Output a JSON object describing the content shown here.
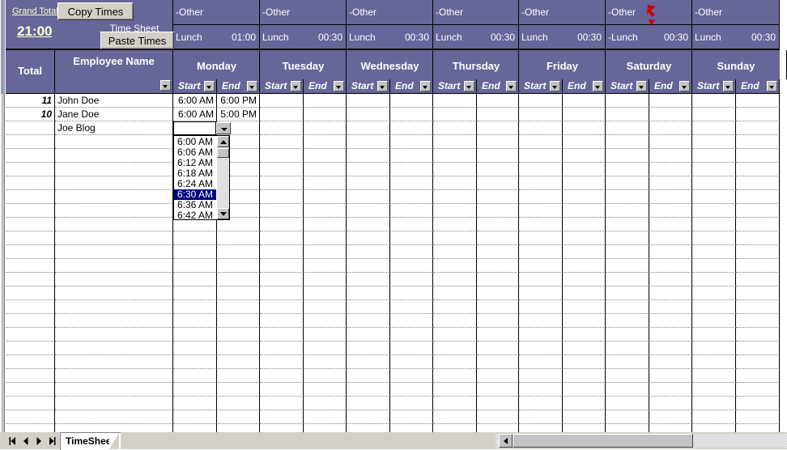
{
  "window": {
    "title": "Time Sheet"
  },
  "summary": {
    "grand_total_label": "Grand Total",
    "grand_total_value": "21:00",
    "sheet_title": "Time Sheet"
  },
  "buttons": {
    "copy_times": "Copy Times",
    "paste_times": "Paste Times"
  },
  "other_label": "-Other",
  "columns": {
    "total": "Total",
    "employee_name": "Employee Name",
    "start": "Start",
    "end": "End"
  },
  "days": [
    {
      "name": "Monday",
      "other": "-Other",
      "lunch_label": "Lunch",
      "lunch_value": "01:00"
    },
    {
      "name": "Tuesday",
      "other": "-Other",
      "lunch_label": "Lunch",
      "lunch_value": "00:30"
    },
    {
      "name": "Wednesday",
      "other": "-Other",
      "lunch_label": "Lunch",
      "lunch_value": "00:30"
    },
    {
      "name": "Thursday",
      "other": "-Other",
      "lunch_label": "Lunch",
      "lunch_value": "00:30"
    },
    {
      "name": "Friday",
      "other": "-Other",
      "lunch_label": "Lunch",
      "lunch_value": "00:30"
    },
    {
      "name": "Saturday",
      "other": "-Other",
      "lunch_label": "-Lunch",
      "lunch_value": "00:30"
    },
    {
      "name": "Sunday",
      "other": "-Other",
      "lunch_label": "Lunch",
      "lunch_value": "00:30"
    }
  ],
  "rows": [
    {
      "total": "11",
      "name": "John Doe",
      "monday_start": "6:00 AM",
      "monday_end": "6:00 PM"
    },
    {
      "total": "10",
      "name": "Jane Doe",
      "monday_start": "6:00 AM",
      "monday_end": "5:00 PM"
    },
    {
      "total": "",
      "name": "Joe Blog",
      "monday_start": "",
      "monday_end": ""
    }
  ],
  "dropdown": {
    "current_value": "",
    "selected": "6:30 AM",
    "options": [
      "6:00 AM",
      "6:06 AM",
      "6:12 AM",
      "6:18 AM",
      "6:24 AM",
      "6:30 AM",
      "6:36 AM",
      "6:42 AM"
    ]
  },
  "sheet_tabs": {
    "active": "TimeSheet",
    "nav": {
      "first": "first-sheet",
      "prev": "previous-sheet",
      "next": "next-sheet",
      "last": "last-sheet"
    }
  },
  "colors": {
    "header_purple": "#666699",
    "header_text": "#ffffff",
    "accent_yellow": "#ffffcc",
    "selection_blue": "#000080",
    "marker_red": "#cc0000",
    "chrome_gray": "#d4d0c8"
  }
}
